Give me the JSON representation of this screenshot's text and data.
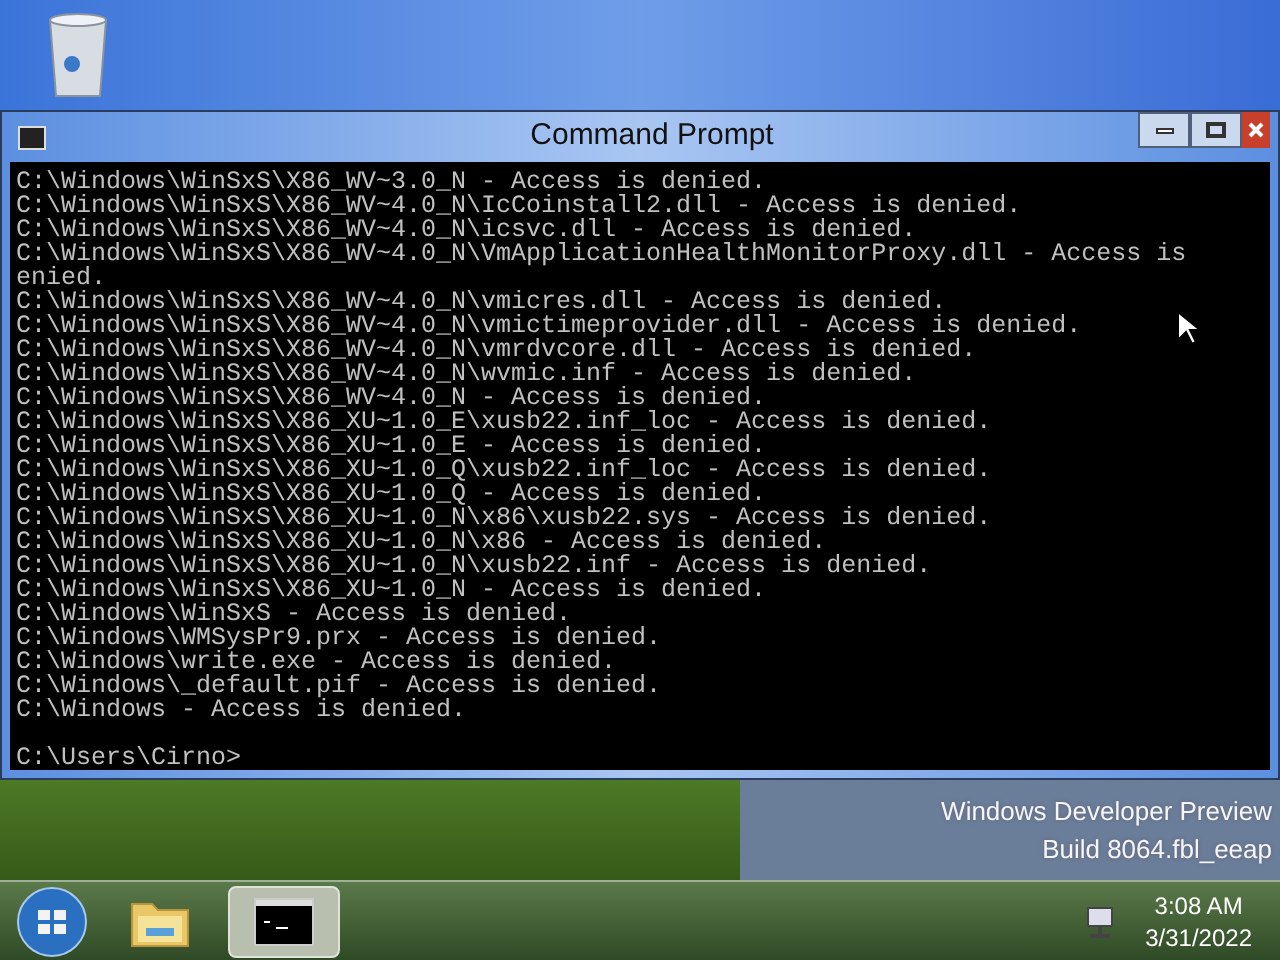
{
  "window": {
    "title": "Command Prompt"
  },
  "console": {
    "lines": [
      "C:\\Windows\\WinSxS\\X86_WV~3.0_N - Access is denied.",
      "C:\\Windows\\WinSxS\\X86_WV~4.0_N\\IcCoinstall2.dll - Access is denied.",
      "C:\\Windows\\WinSxS\\X86_WV~4.0_N\\icsvc.dll - Access is denied.",
      "C:\\Windows\\WinSxS\\X86_WV~4.0_N\\VmApplicationHealthMonitorProxy.dll - Access is",
      "enied.",
      "C:\\Windows\\WinSxS\\X86_WV~4.0_N\\vmicres.dll - Access is denied.",
      "C:\\Windows\\WinSxS\\X86_WV~4.0_N\\vmictimeprovider.dll - Access is denied.",
      "C:\\Windows\\WinSxS\\X86_WV~4.0_N\\vmrdvcore.dll - Access is denied.",
      "C:\\Windows\\WinSxS\\X86_WV~4.0_N\\wvmic.inf - Access is denied.",
      "C:\\Windows\\WinSxS\\X86_WV~4.0_N - Access is denied.",
      "C:\\Windows\\WinSxS\\X86_XU~1.0_E\\xusb22.inf_loc - Access is denied.",
      "C:\\Windows\\WinSxS\\X86_XU~1.0_E - Access is denied.",
      "C:\\Windows\\WinSxS\\X86_XU~1.0_Q\\xusb22.inf_loc - Access is denied.",
      "C:\\Windows\\WinSxS\\X86_XU~1.0_Q - Access is denied.",
      "C:\\Windows\\WinSxS\\X86_XU~1.0_N\\x86\\xusb22.sys - Access is denied.",
      "C:\\Windows\\WinSxS\\X86_XU~1.0_N\\x86 - Access is denied.",
      "C:\\Windows\\WinSxS\\X86_XU~1.0_N\\xusb22.inf - Access is denied.",
      "C:\\Windows\\WinSxS\\X86_XU~1.0_N - Access is denied.",
      "C:\\Windows\\WinSxS - Access is denied.",
      "C:\\Windows\\WMSysPr9.prx - Access is denied.",
      "C:\\Windows\\write.exe - Access is denied.",
      "C:\\Windows\\_default.pif - Access is denied.",
      "C:\\Windows - Access is denied."
    ],
    "prompt": "C:\\Users\\Cirno>"
  },
  "desktop": {
    "watermark": [
      "Windows Developer Preview",
      "Build 8064.fbl_eeap"
    ]
  },
  "taskbar": {
    "items": [
      {
        "kind": "folder",
        "selected": false
      },
      {
        "kind": "console",
        "selected": true
      }
    ],
    "clock": {
      "time": "3:08 AM",
      "date": "3/31/2022"
    }
  }
}
